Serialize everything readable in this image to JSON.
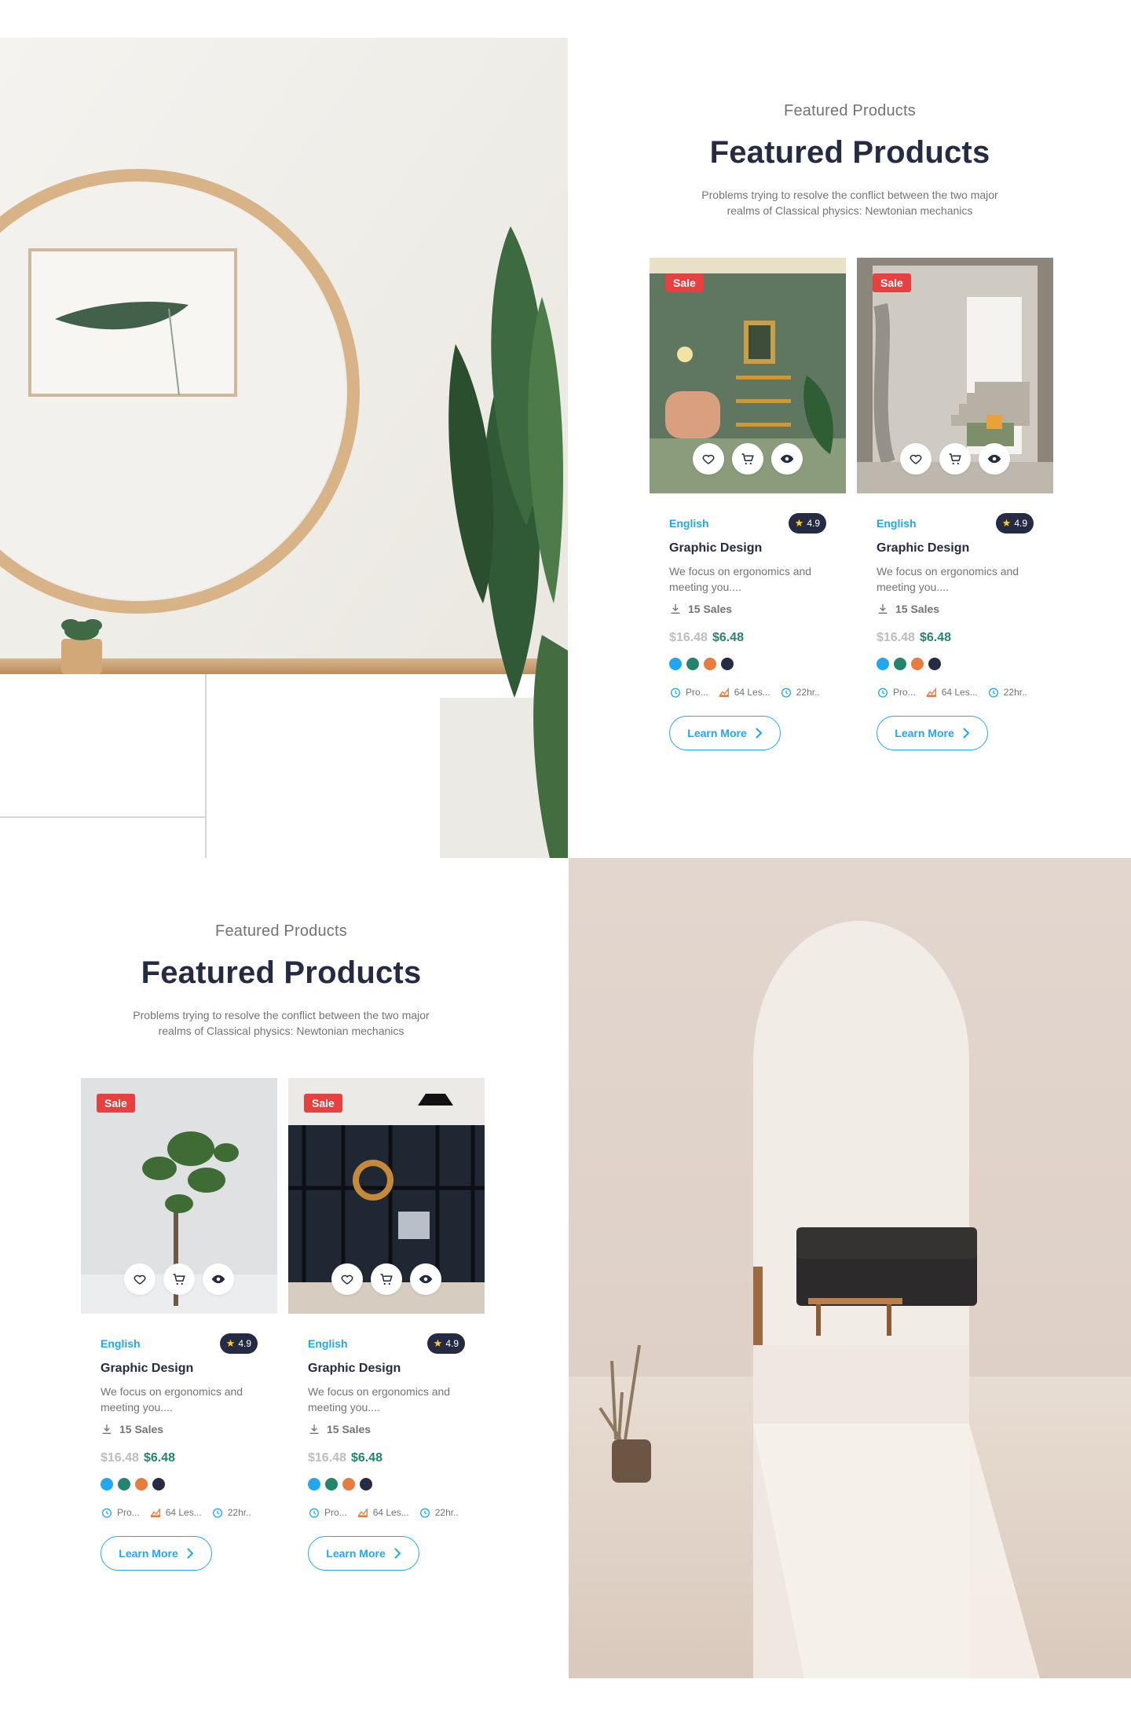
{
  "sections": [
    {
      "eyebrow": "Featured Products",
      "heading": "Featured Products",
      "subtext": "Problems trying to resolve the conflict between the two major realms of Classical physics: Newtonian mechanics",
      "cards": [
        {
          "badge": "Sale",
          "category": "English",
          "rating": "4.9",
          "title": "Graphic Design",
          "description": "We focus on ergonomics and meeting you....",
          "sales": "15 Sales",
          "old_price": "$16.48",
          "new_price": "$6.48",
          "colors": [
            "#23A6F0",
            "#23856D",
            "#E77C40",
            "#252B42"
          ],
          "meta": {
            "duration": "Pro...",
            "lessons": "64 Les...",
            "hours": "22hr.."
          },
          "button": "Learn More",
          "image": "living-room-photo"
        },
        {
          "badge": "Sale",
          "category": "English",
          "rating": "4.9",
          "title": "Graphic Design",
          "description": "We focus on ergonomics and meeting you....",
          "sales": "15 Sales",
          "old_price": "$16.48",
          "new_price": "$6.48",
          "colors": [
            "#23A6F0",
            "#23856D",
            "#E77C40",
            "#252B42"
          ],
          "meta": {
            "duration": "Pro...",
            "lessons": "64 Les...",
            "hours": "22hr.."
          },
          "button": "Learn More",
          "image": "stairway-photo"
        }
      ]
    },
    {
      "eyebrow": "Featured Products",
      "heading": "Featured Products",
      "subtext": "Problems trying to resolve the conflict between the two major realms of Classical physics: Newtonian mechanics",
      "cards": [
        {
          "badge": "Sale",
          "category": "English",
          "rating": "4.9",
          "title": "Graphic Design",
          "description": "We focus on ergonomics and meeting you....",
          "sales": "15 Sales",
          "old_price": "$16.48",
          "new_price": "$6.48",
          "colors": [
            "#23A6F0",
            "#23856D",
            "#E77C40",
            "#252B42"
          ],
          "meta": {
            "duration": "Pro...",
            "lessons": "64 Les...",
            "hours": "22hr.."
          },
          "button": "Learn More",
          "image": "plant-photo"
        },
        {
          "badge": "Sale",
          "category": "English",
          "rating": "4.9",
          "title": "Graphic Design",
          "description": "We focus on ergonomics and meeting you....",
          "sales": "15 Sales",
          "old_price": "$16.48",
          "new_price": "$6.48",
          "colors": [
            "#23A6F0",
            "#23856D",
            "#E77C40",
            "#252B42"
          ],
          "meta": {
            "duration": "Pro...",
            "lessons": "64 Les...",
            "hours": "22hr.."
          },
          "button": "Learn More",
          "image": "dark-interior-photo"
        }
      ]
    }
  ],
  "icons": {
    "wishlist": "heart-icon",
    "cart": "cart-icon",
    "view": "eye-icon",
    "sales": "download-icon",
    "duration": "alarm-clock-icon",
    "lessons": "chart-area-icon",
    "hours": "alarm-clock-icon",
    "button_arrow": "chevron-right-icon"
  },
  "theme": {
    "primary": "#23A6F0",
    "dark": "#252B42",
    "muted": "#737373",
    "sale": "#E74040",
    "success": "#23856D",
    "accent": "#E77C40"
  }
}
